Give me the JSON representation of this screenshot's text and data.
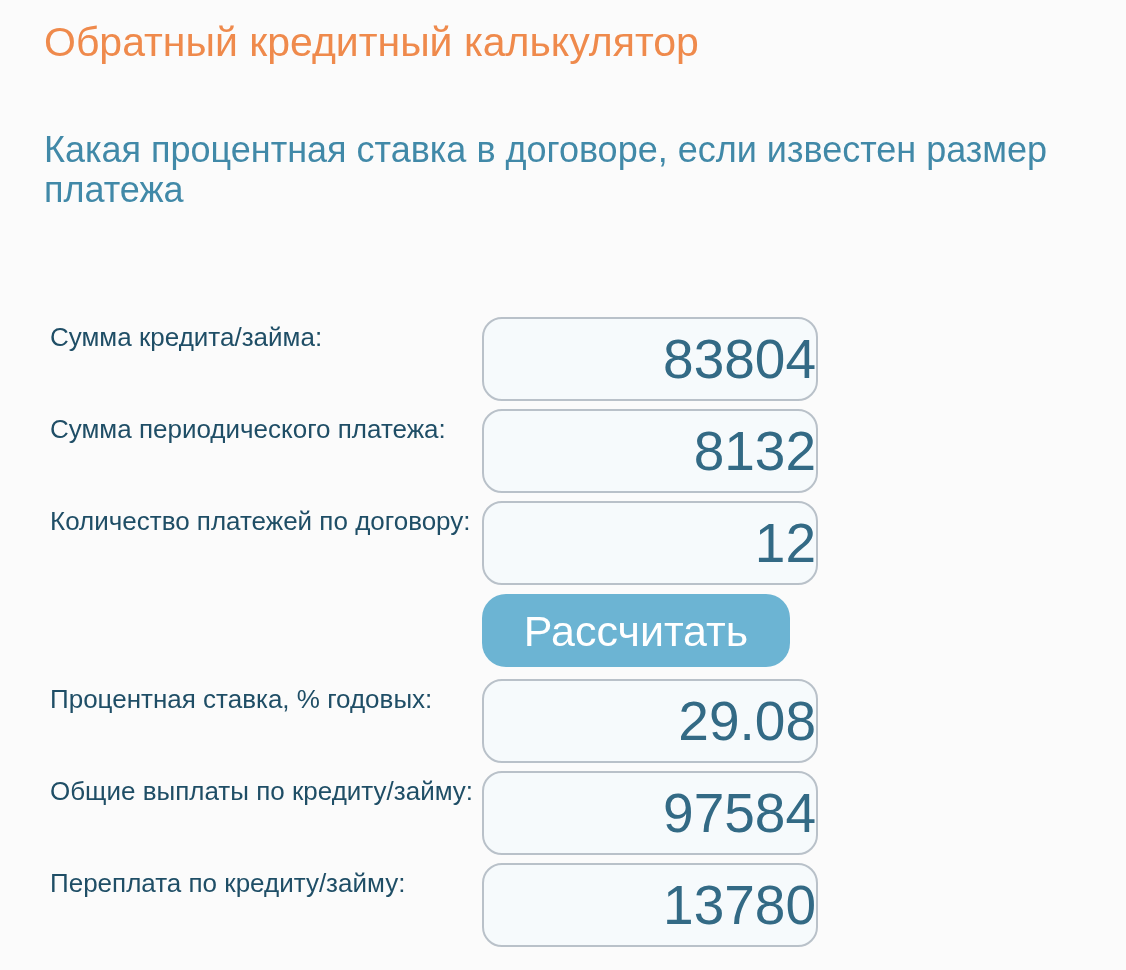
{
  "title": "Обратный кредитный калькулятор",
  "subtitle": "Какая процентная ставка в договоре, если известен размер платежа",
  "inputs": [
    {
      "label": "Сумма кредита/займа:",
      "value": "83804"
    },
    {
      "label": "Сумма периодического платежа:",
      "value": "8132"
    },
    {
      "label": "Количество платежей по договору:",
      "value": "12"
    }
  ],
  "button": {
    "label": "Рассчитать"
  },
  "results": [
    {
      "label": "Процентная ставка, % годовых:",
      "value": "29.08"
    },
    {
      "label": "Общие выплаты по кредиту/займу:",
      "value": "97584"
    },
    {
      "label": "Переплата по кредиту/займу:",
      "value": "13780"
    }
  ]
}
